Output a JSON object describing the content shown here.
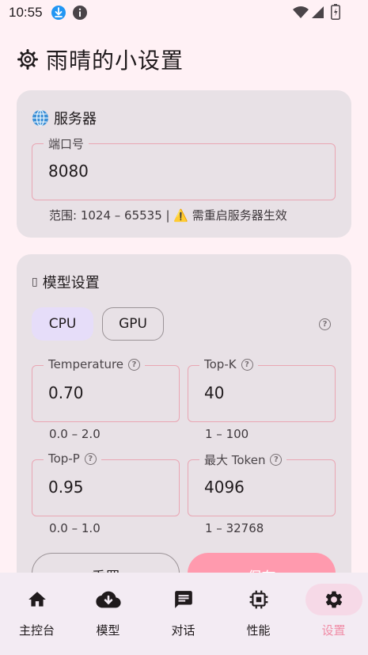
{
  "status_bar": {
    "time": "10:55"
  },
  "header": {
    "title": "雨晴的小设置"
  },
  "server_card": {
    "title": "服务器",
    "port_label": "端口号",
    "port_value": "8080",
    "hint": "范围: 1024 – 65535 | ⚠️ 需重启服务器生效"
  },
  "model_card": {
    "title": "模型设置",
    "title_prefix": "▯",
    "device_options": [
      "CPU",
      "GPU"
    ],
    "selected_device": "CPU",
    "fields": {
      "temperature": {
        "label": "Temperature",
        "value": "0.70",
        "range": "0.0 – 2.0"
      },
      "top_k": {
        "label": "Top-K",
        "value": "40",
        "range": "1 – 100"
      },
      "top_p": {
        "label": "Top-P",
        "value": "0.95",
        "range": "0.0 – 1.0"
      },
      "max_token": {
        "label": "最大 Token",
        "value": "4096",
        "range": "1 – 32768"
      }
    },
    "reset_label": "重置",
    "save_label": "保存"
  },
  "bottom_nav": {
    "items": [
      {
        "label": "主控台",
        "icon": "home-icon"
      },
      {
        "label": "模型",
        "icon": "cloud-download-icon"
      },
      {
        "label": "对话",
        "icon": "chat-icon"
      },
      {
        "label": "性能",
        "icon": "chip-icon"
      },
      {
        "label": "设置",
        "icon": "gear-icon"
      }
    ],
    "active": "设置"
  },
  "colors": {
    "background": "#FFF1F5",
    "card": "#E8E1E6",
    "field_border": "#E9A6B3",
    "save_button": "#FF9AAE",
    "active_nav": "#F08CA6",
    "nav_pill": "#F6D9E7",
    "segment_selected": "#E6DDF9"
  }
}
